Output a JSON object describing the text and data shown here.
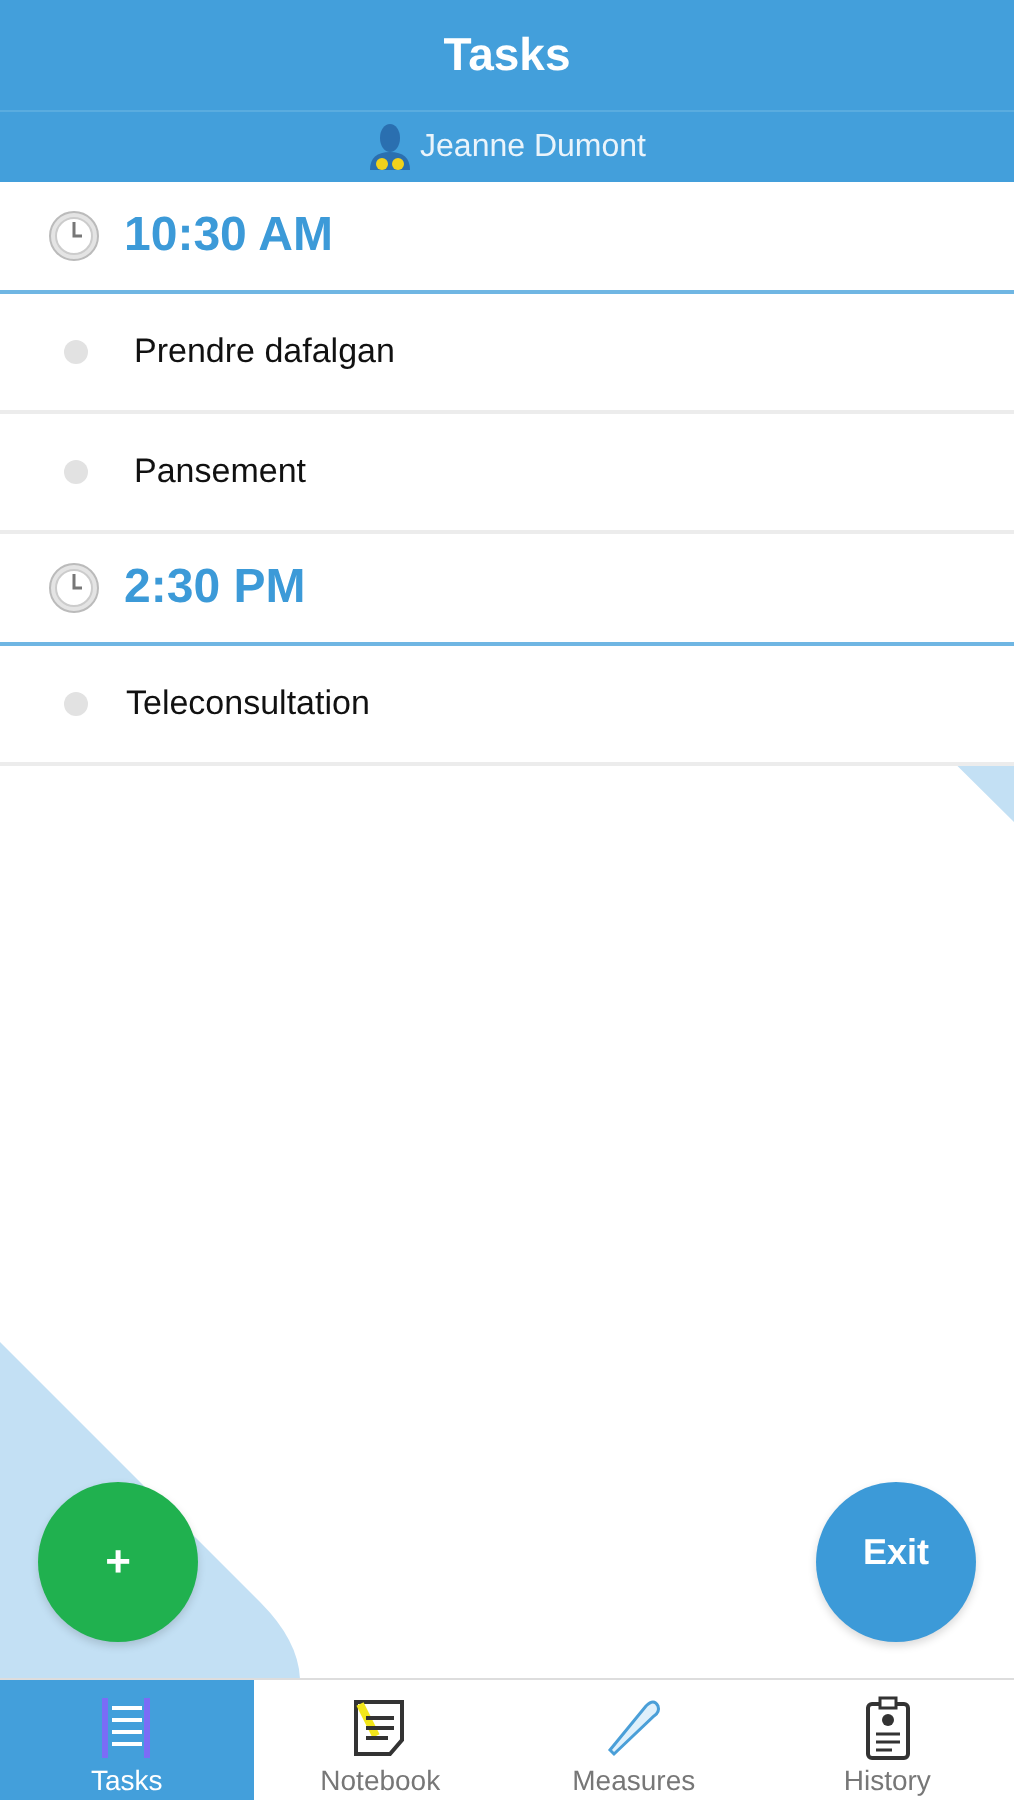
{
  "header": {
    "title": "Tasks",
    "user": "Jeanne Dumont"
  },
  "groups": [
    {
      "time": "10:30 AM",
      "tasks": [
        {
          "label": "Prendre dafalgan"
        },
        {
          "label": "Pansement"
        }
      ]
    },
    {
      "time": "2:30 PM",
      "tasks": [
        {
          "label": "Teleconsultation"
        }
      ]
    }
  ],
  "add_button": "+",
  "exit_button": "Exit",
  "tabs": [
    {
      "label": "Tasks",
      "kind": "tasks",
      "selected": true
    },
    {
      "label": "Notebook",
      "kind": "notebook",
      "selected": false
    },
    {
      "label": "Measures",
      "kind": "measures",
      "selected": false
    },
    {
      "label": "History",
      "kind": "history",
      "selected": false
    }
  ]
}
